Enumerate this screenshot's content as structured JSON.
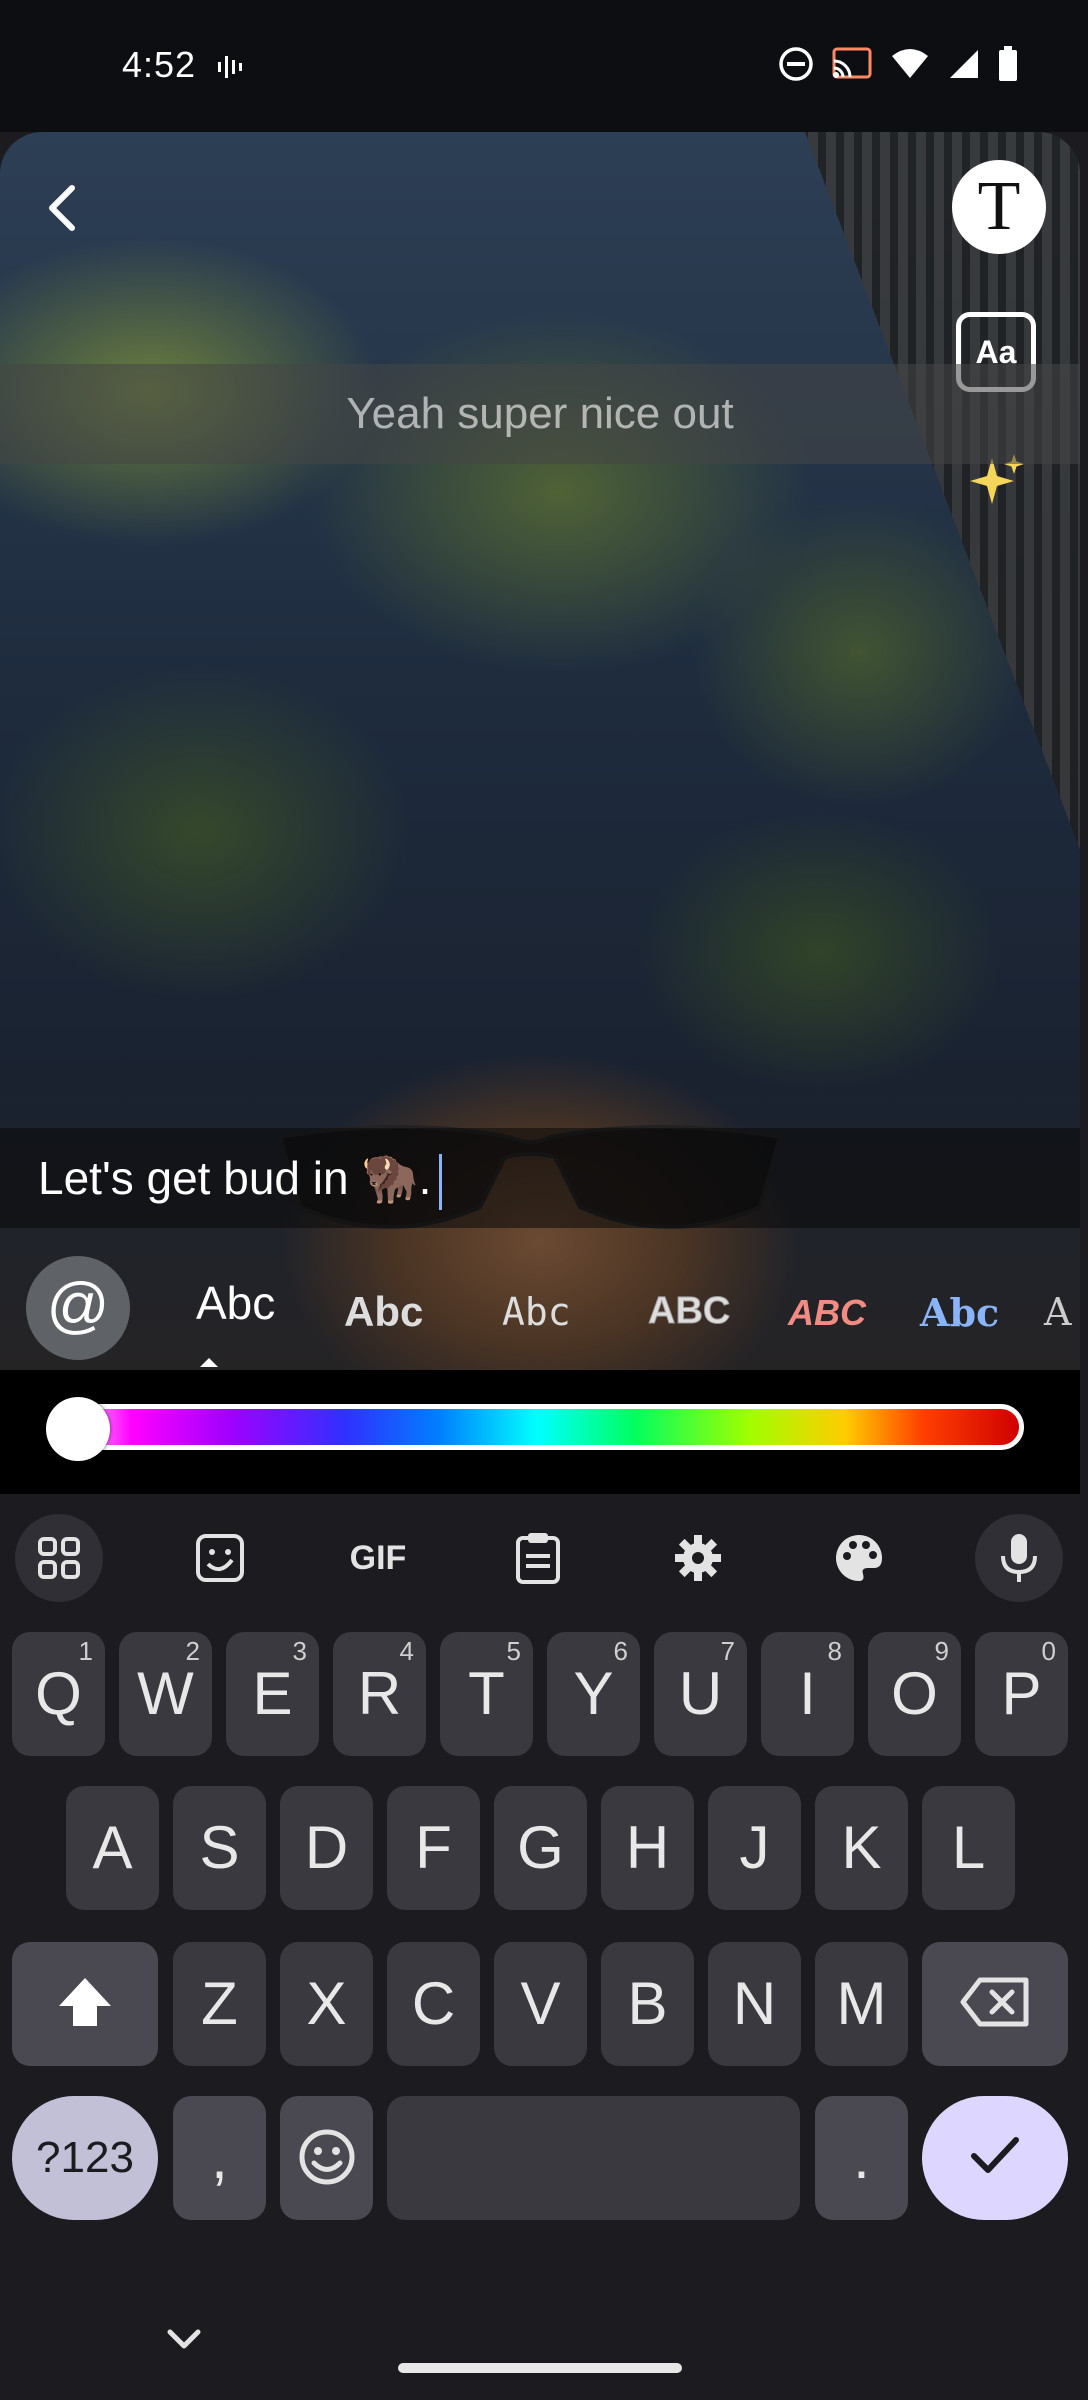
{
  "status_bar": {
    "time": "4:52",
    "icons": [
      "soundwave-icon",
      "do-not-disturb-icon",
      "cast-icon",
      "wifi-icon",
      "signal-icon",
      "battery-icon"
    ]
  },
  "editor": {
    "tools": {
      "text_tool": "T",
      "font_tool": "Aa"
    },
    "caption_previous": "Yeah super nice out",
    "caption_current": "Let's get bud in 🦬."
  },
  "font_picker": {
    "mention_symbol": "@",
    "options": [
      "Abc",
      "Abc",
      "Abc",
      "ABC",
      "ABC",
      "Abc",
      "A"
    ],
    "selected_index": 0
  },
  "color_slider": {
    "selected_position": 0,
    "selected_color": "#ffffff"
  },
  "keyboard": {
    "toolbar": [
      "apps-grid-icon",
      "sticker-icon",
      "GIF",
      "clipboard-icon",
      "settings-icon",
      "palette-icon",
      "mic-icon"
    ],
    "gif_label": "GIF",
    "row1": [
      {
        "k": "Q",
        "h": "1"
      },
      {
        "k": "W",
        "h": "2"
      },
      {
        "k": "E",
        "h": "3"
      },
      {
        "k": "R",
        "h": "4"
      },
      {
        "k": "T",
        "h": "5"
      },
      {
        "k": "Y",
        "h": "6"
      },
      {
        "k": "U",
        "h": "7"
      },
      {
        "k": "I",
        "h": "8"
      },
      {
        "k": "O",
        "h": "9"
      },
      {
        "k": "P",
        "h": "0"
      }
    ],
    "row2": [
      "A",
      "S",
      "D",
      "F",
      "G",
      "H",
      "J",
      "K",
      "L"
    ],
    "row3": [
      "Z",
      "X",
      "C",
      "V",
      "B",
      "N",
      "M"
    ],
    "symbols_label": "?123",
    "comma": ",",
    "period": "."
  },
  "colors": {
    "keyboard_bg": "#1c1b1f",
    "key_bg": "#3a393f",
    "enter_bg": "#ddd6ff",
    "symbols_bg": "#c2c0d6"
  }
}
